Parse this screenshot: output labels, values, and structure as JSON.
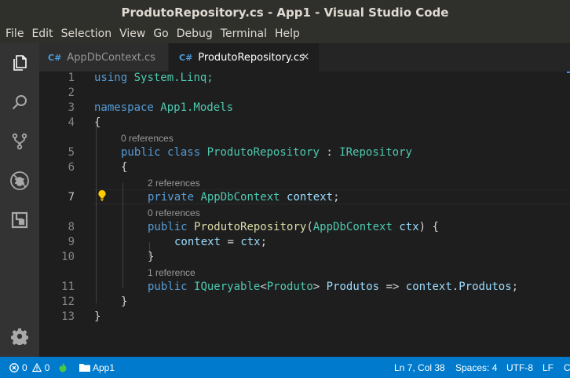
{
  "window": {
    "title": "ProdutoRepository.cs - App1 - Visual Studio Code"
  },
  "menu": [
    "File",
    "Edit",
    "Selection",
    "View",
    "Go",
    "Debug",
    "Terminal",
    "Help"
  ],
  "activity_bar": {
    "items": [
      "files-icon",
      "search-icon",
      "source-control-icon",
      "debug-icon",
      "extensions-icon"
    ],
    "bottom": "gear-icon"
  },
  "tabs": [
    {
      "label": "AppDbContext.cs",
      "icon_text": "C#",
      "active": false
    },
    {
      "label": "ProdutoRepository.cs",
      "icon_text": "C#",
      "active": true,
      "close": "×"
    }
  ],
  "editor": {
    "line_numbers": [
      "1",
      "2",
      "3",
      "4",
      "5",
      "6",
      "7",
      "8",
      "9",
      "10",
      "11",
      "12",
      "13"
    ],
    "current_line": "7",
    "code_lens": [
      "0 references",
      "2 references",
      "0 references",
      "1 reference"
    ],
    "lines": {
      "l1": [
        "using",
        " System.Linq;"
      ],
      "l3": [
        "namespace",
        " App1.Models"
      ],
      "l4": "{",
      "l5": [
        "public",
        " ",
        "class",
        " ",
        "ProdutoRepository",
        " : ",
        "IRepository"
      ],
      "l6": "{",
      "l7": [
        "private",
        " ",
        "AppDbContext",
        " ",
        "context",
        ";"
      ],
      "l8": [
        "public",
        " ",
        "ProdutoRepository",
        "(",
        "AppDbContext",
        " ",
        "ctx",
        ") {"
      ],
      "l9": [
        "context",
        " = ",
        "ctx",
        ";"
      ],
      "l10": "}",
      "l11": [
        "public",
        " ",
        "IQueryable",
        "<",
        "Produto",
        "> ",
        "Produtos",
        " => ",
        "context",
        ".",
        "Produtos",
        ";"
      ],
      "l12": "}",
      "l13": "}"
    }
  },
  "status_bar": {
    "errors": "0",
    "warnings": "0",
    "folder": "App1",
    "position": "Ln 7, Col 38",
    "indent": "Spaces: 4",
    "encoding": "UTF-8",
    "eol": "LF",
    "language_partial": "C"
  },
  "colors": {
    "keyword": "#569cd6",
    "type": "#4ec9b0",
    "function": "#dcdcaa",
    "variable": "#9cdcfe",
    "status_bar": "#007acc",
    "title_bar": "#2f2f2c"
  }
}
